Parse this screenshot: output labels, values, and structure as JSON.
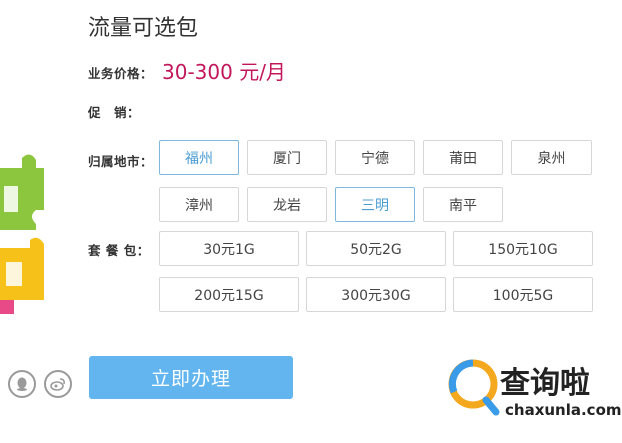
{
  "header": {
    "title": "流量可选包"
  },
  "price": {
    "label": "业务价格：",
    "value": "30-300 元/月"
  },
  "promo": {
    "label": "促　销："
  },
  "region": {
    "label": "归属地市：",
    "options": [
      "福州",
      "厦门",
      "宁德",
      "莆田",
      "泉州",
      "漳州",
      "龙岩",
      "三明",
      "南平"
    ]
  },
  "package": {
    "label": "套 餐 包：",
    "options": [
      "30元1G",
      "50元2G",
      "150元10G",
      "200元15G",
      "300元30G",
      "100元5G"
    ]
  },
  "action": {
    "submit_label": "立即办理"
  },
  "watermark": {
    "text": "查询啦",
    "domain": "chaxunla.com"
  },
  "colors": {
    "accent": "#62b5ee",
    "price": "#c2185b",
    "selected_border": "#7fb8df",
    "selected_text": "#4b9cd3"
  }
}
